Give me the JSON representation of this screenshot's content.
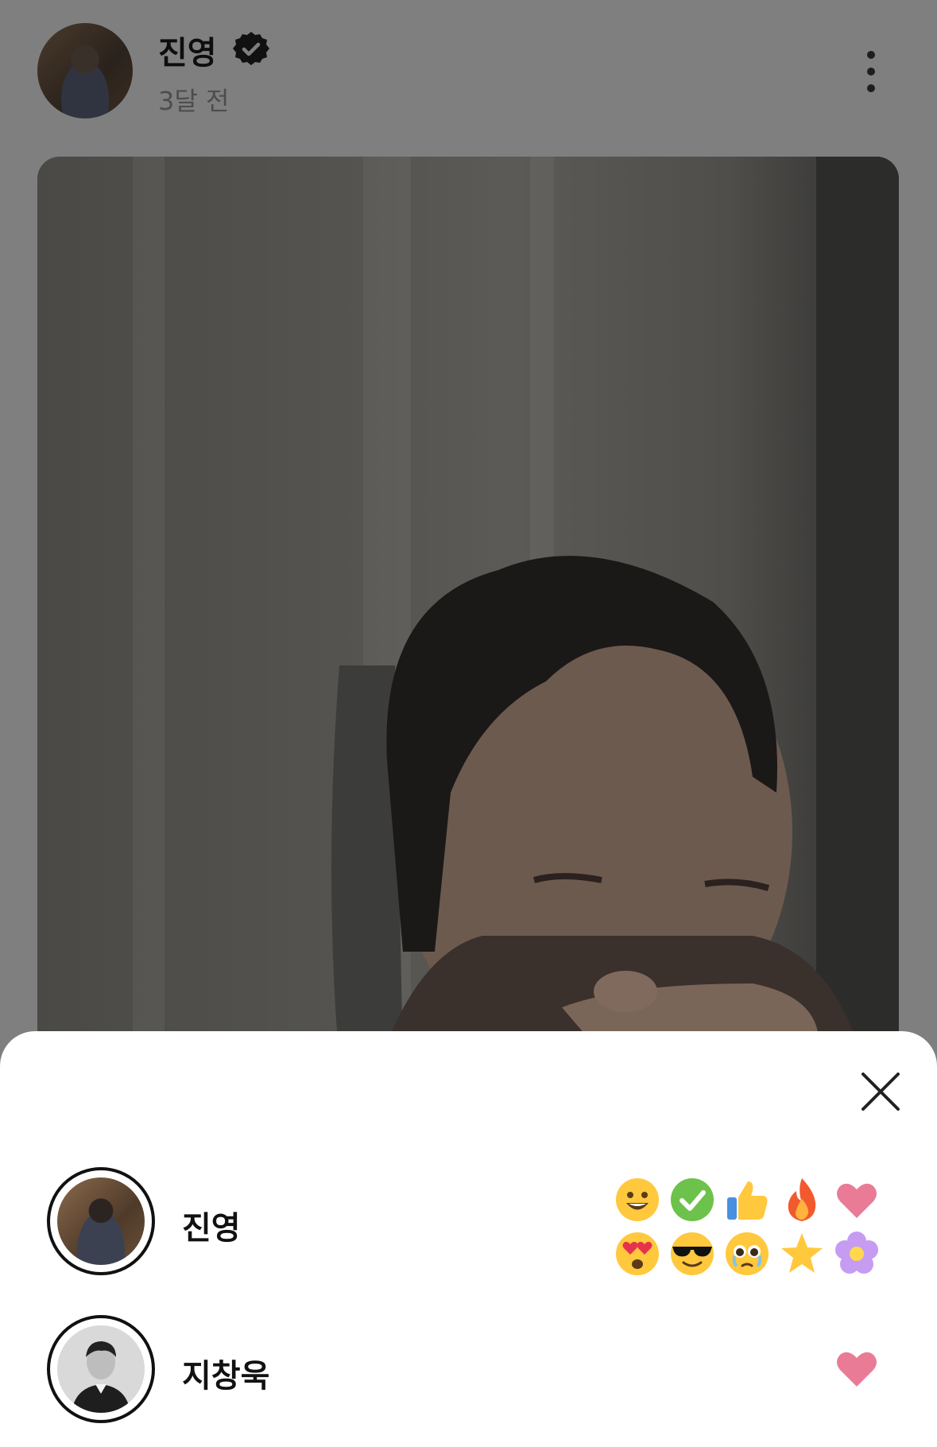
{
  "post": {
    "author": "진영",
    "time": "3달 전"
  },
  "reactions": [
    {
      "name": "진영",
      "emojis": [
        "grinning-face",
        "check-mark",
        "thumbs-up",
        "fire",
        "heart",
        "heart-eyes",
        "sunglasses-face",
        "pleading-face",
        "star",
        "flower"
      ]
    },
    {
      "name": "지창욱",
      "emojis": [
        "heart"
      ]
    }
  ],
  "colors": {
    "overlay": "#7f7f7f",
    "heart": "#e97b97",
    "check": "#6cc24a",
    "emoji_yellow": "#ffc83d"
  }
}
